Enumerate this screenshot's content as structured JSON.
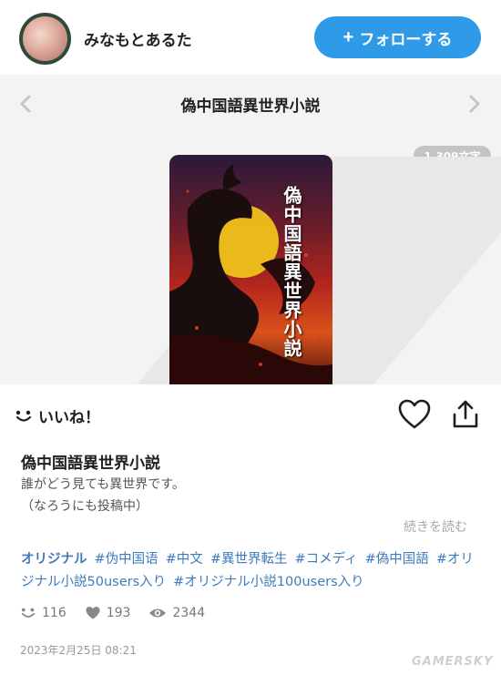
{
  "header": {
    "username": "みなもとあるた",
    "follow_label": "フォローする",
    "follow_plus": "+"
  },
  "gallery": {
    "title": "偽中国語異世界小説",
    "char_count": "1,309文字",
    "cover_title": "偽中国語異世界小説",
    "prev_icon": "chevron-left-icon",
    "next_icon": "chevron-right-icon"
  },
  "actions": {
    "like_label": "いいね！",
    "heart_icon": "heart-outline-icon",
    "share_icon": "share-icon"
  },
  "description": {
    "title": "偽中国語異世界小説",
    "line1": "誰がどう見ても異世界です。",
    "line2": "（なろうにも投稿中）",
    "read_more": "続きを読む"
  },
  "tags": {
    "original": "オリジナル",
    "items": [
      "#伪中国语",
      "#中文",
      "#異世界転生",
      "#コメディ",
      "#偽中国語",
      "#オリジナル小説50users入り",
      "#オリジナル小説100users入り"
    ]
  },
  "stats": {
    "likes": "116",
    "bookmarks": "193",
    "views": "2344"
  },
  "date": "2023年2月25日 08:21",
  "watermark": "GAMERSKY",
  "colors": {
    "follow_button": "#2f9ae8",
    "tag_link": "#3d7bbd",
    "gallery_bg": "#f3f3f3",
    "badge_bg": "#c4c4c4"
  }
}
